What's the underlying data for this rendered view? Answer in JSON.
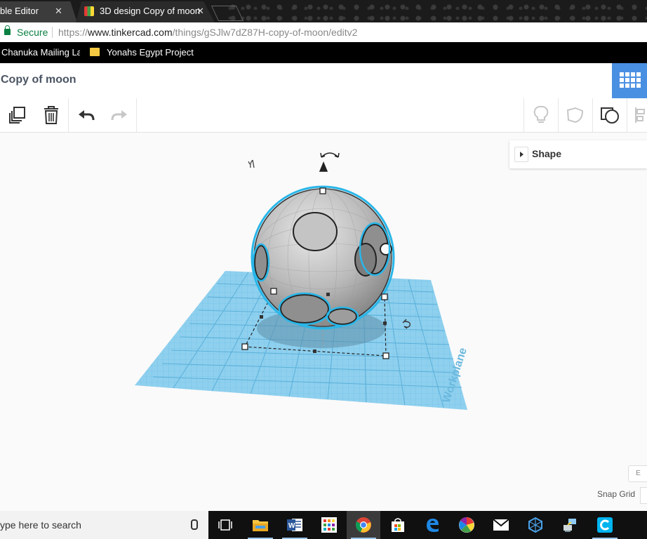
{
  "browser": {
    "tabs": [
      {
        "label": "ble Editor",
        "close": "✕"
      },
      {
        "label": "3D design Copy of moon",
        "close": "✕"
      }
    ],
    "address": {
      "secure_label": "Secure",
      "url_scheme": "https://",
      "url_host": "www.tinkercad.com",
      "url_path": "/things/gSJlw7dZ87H-copy-of-moon/editv2"
    },
    "bookmarks": [
      {
        "label": "Chanuka Mailing Labels"
      },
      {
        "label": "Yonahs Egypt Project"
      }
    ]
  },
  "app": {
    "design_title": "Copy of moon",
    "toolbar": {
      "left_icons": [
        "copy-icon",
        "trash-icon",
        "undo-icon",
        "redo-icon"
      ],
      "right_icons": [
        "lightbulb-icon",
        "hole-shape-icon",
        "solid-shape-icon",
        "align-icon"
      ]
    },
    "shape_panel": {
      "label": "Shape"
    },
    "workplane_label": "Workplane",
    "bottom_box_label": "E",
    "snap_grid_label": "Snap Grid"
  },
  "colors": {
    "accent": "#4a90e2",
    "workplane": "#7ec8ea",
    "selection": "#29b6e8"
  },
  "taskbar": {
    "search_placeholder": "ype here to search",
    "apps": [
      "task-view-icon",
      "file-explorer-icon",
      "word-icon",
      "app-grid-icon",
      "chrome-icon",
      "store-icon",
      "edge-icon",
      "photos-icon",
      "mail-icon",
      "app-icon",
      "network-app-icon",
      "c-app-icon"
    ]
  }
}
